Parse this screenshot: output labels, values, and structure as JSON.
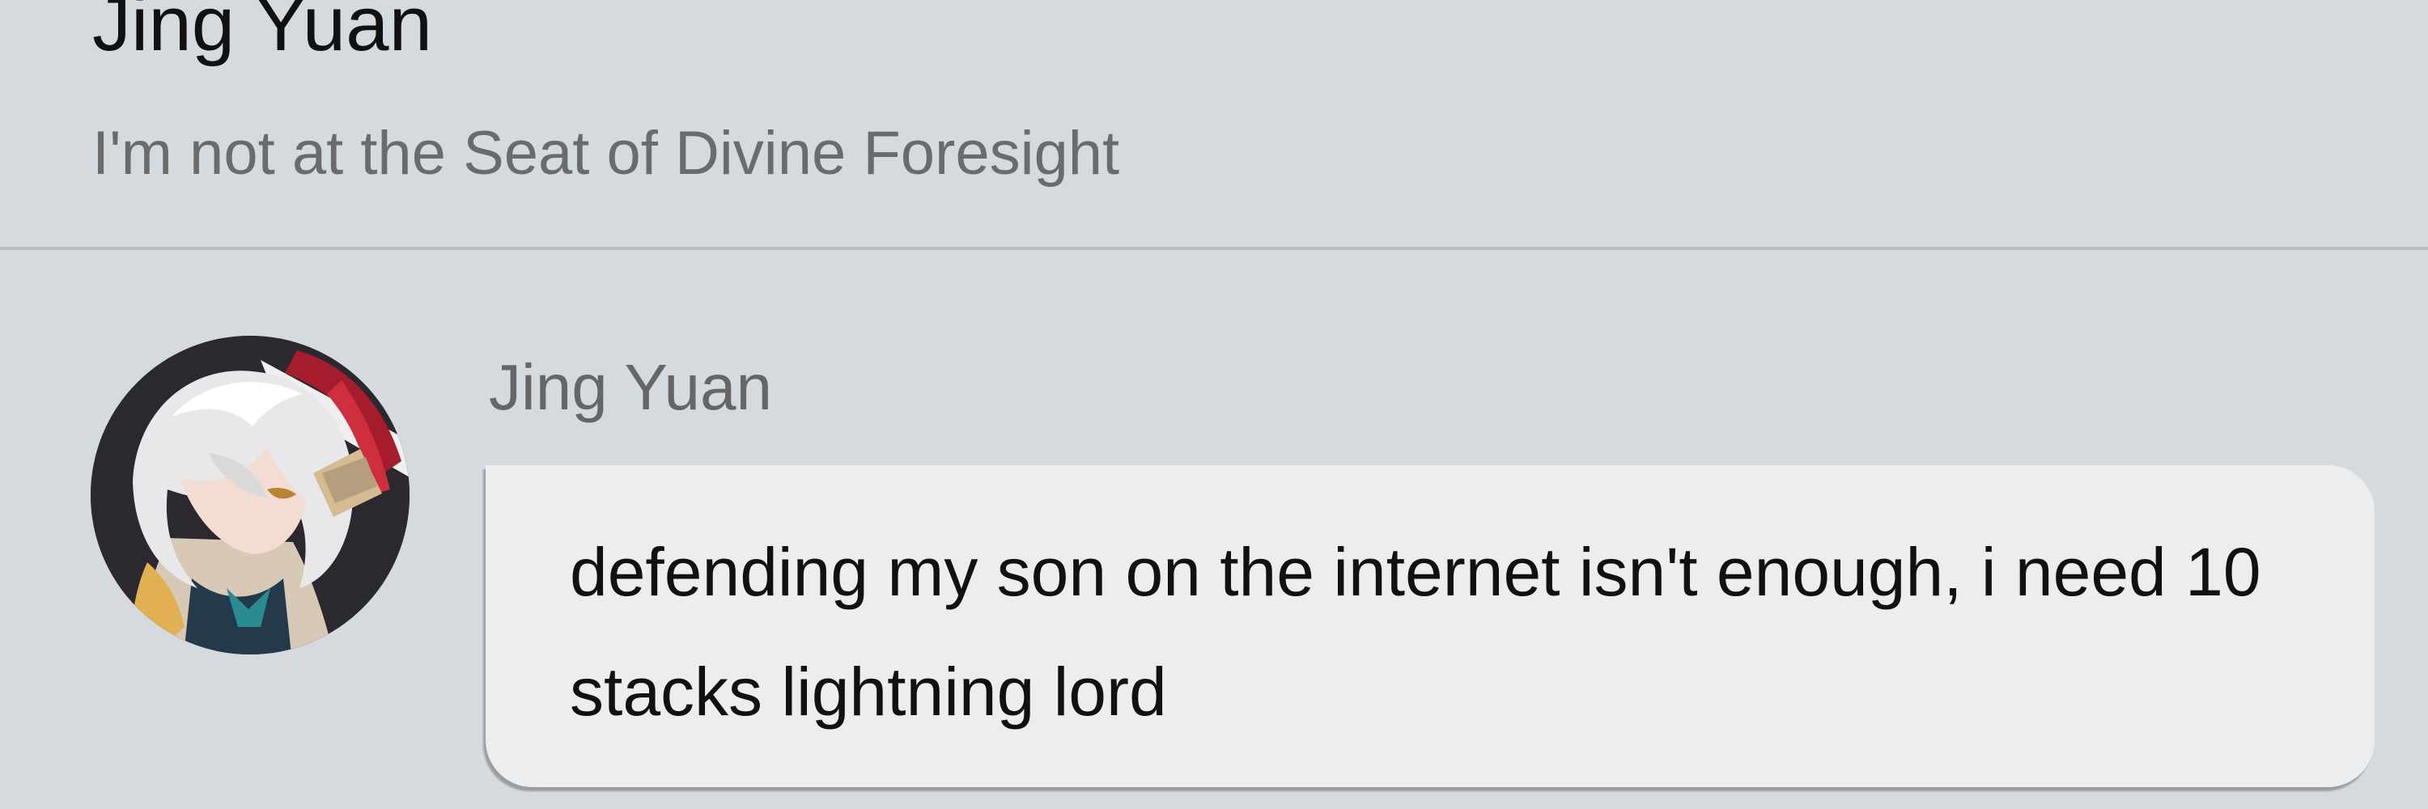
{
  "header": {
    "contact_name": "Jing Yuan",
    "status": "I'm not at the Seat of Divine Foresight"
  },
  "message": {
    "sender": "Jing Yuan",
    "text": "defending my son on the internet isn't enough, i need 10 stacks lightning lord",
    "avatar_icon": "anime-character-avatar"
  },
  "colors": {
    "background": "#d5dadf",
    "bubble": "#ededed",
    "divider": "#b8bec4",
    "primary_text": "#111111",
    "secondary_text": "#6b6b6b"
  }
}
